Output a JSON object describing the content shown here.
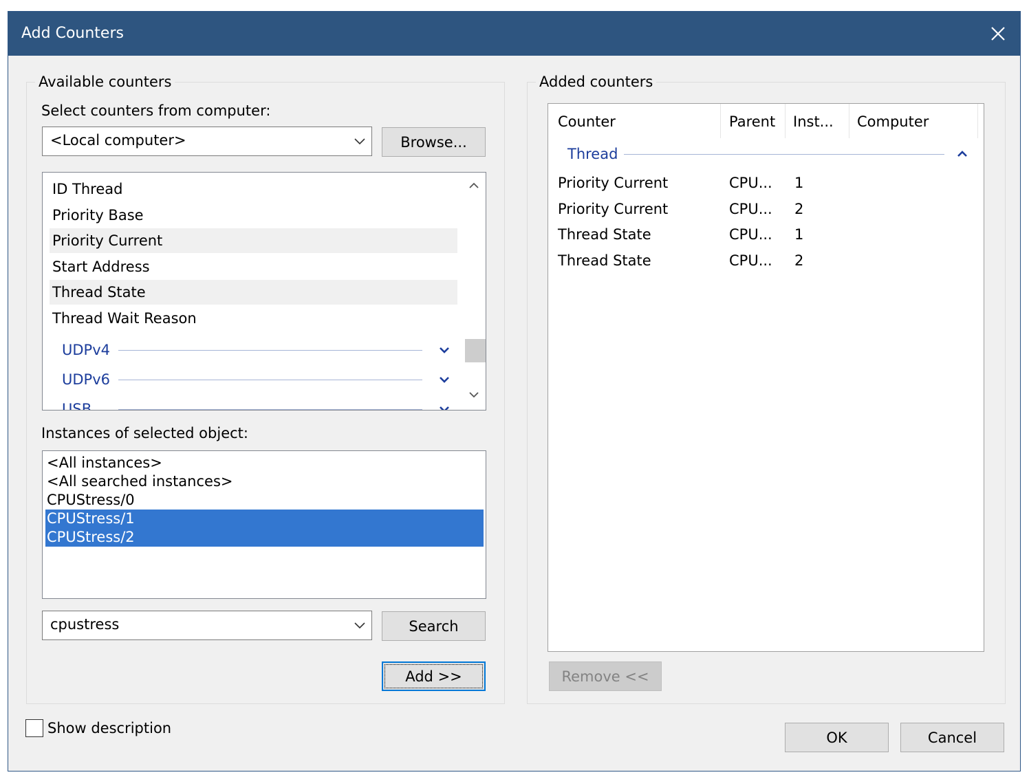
{
  "window": {
    "title": "Add Counters",
    "accent_color": "#2e5580",
    "close_icon": "close-icon"
  },
  "available": {
    "legend": "Available counters",
    "computer_label": "Select counters from computer:",
    "computer_value": "<Local computer>",
    "browse_label": "Browse...",
    "counters": [
      {
        "label": "ID Thread",
        "highlight": false
      },
      {
        "label": "Priority Base",
        "highlight": false
      },
      {
        "label": "Priority Current",
        "highlight": true
      },
      {
        "label": "Start Address",
        "highlight": false
      },
      {
        "label": "Thread State",
        "highlight": true
      },
      {
        "label": "Thread Wait Reason",
        "highlight": false
      }
    ],
    "object_groups": [
      {
        "label": "UDPv4",
        "icon": "chevron-down-icon"
      },
      {
        "label": "UDPv6",
        "icon": "chevron-down-icon"
      },
      {
        "label": "USB",
        "icon": "chevron-down-icon"
      }
    ],
    "instances_label": "Instances of selected object:",
    "instances": [
      {
        "label": "<All instances>",
        "selected": false
      },
      {
        "label": "<All searched instances>",
        "selected": false
      },
      {
        "label": "CPUStress/0",
        "selected": false
      },
      {
        "label": "CPUStress/1",
        "selected": true
      },
      {
        "label": "CPUStress/2",
        "selected": true
      }
    ],
    "search_value": "cpustress",
    "search_label": "Search",
    "add_label": "Add >>"
  },
  "added": {
    "legend": "Added counters",
    "columns": [
      "Counter",
      "Parent",
      "Inst...",
      "Computer"
    ],
    "group": "Thread",
    "rows": [
      {
        "counter": "Priority Current",
        "parent": "CPU...",
        "instance": "1",
        "computer": ""
      },
      {
        "counter": "Priority Current",
        "parent": "CPU...",
        "instance": "2",
        "computer": ""
      },
      {
        "counter": "Thread State",
        "parent": "CPU...",
        "instance": "1",
        "computer": ""
      },
      {
        "counter": "Thread State",
        "parent": "CPU...",
        "instance": "2",
        "computer": ""
      }
    ],
    "remove_label": "Remove <<"
  },
  "footer": {
    "show_description_label": "Show description",
    "show_description_checked": false,
    "ok_label": "OK",
    "cancel_label": "Cancel"
  }
}
